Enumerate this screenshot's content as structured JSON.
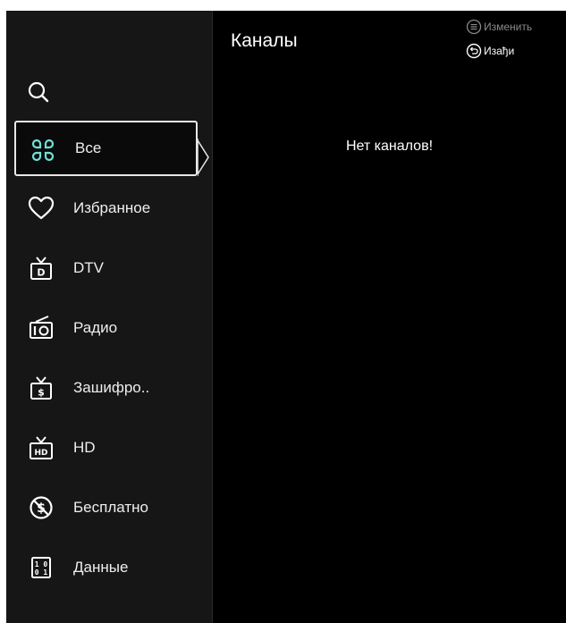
{
  "header": {
    "title": "Каналы",
    "hints": {
      "edit_label": "Изменить",
      "back_label": "Изађи"
    }
  },
  "sidebar": {
    "search_icon": "search-icon",
    "selected_index": 0,
    "items": [
      {
        "label": "Все",
        "icon": "grid-icon",
        "selected": true
      },
      {
        "label": "Избранное",
        "icon": "heart-icon",
        "selected": false
      },
      {
        "label": "DTV",
        "icon": "tv-d-icon",
        "selected": false
      },
      {
        "label": "Радио",
        "icon": "radio-icon",
        "selected": false
      },
      {
        "label": "Зашифро..",
        "icon": "encrypted-tv-icon",
        "selected": false
      },
      {
        "label": "HD",
        "icon": "hd-tv-icon",
        "selected": false
      },
      {
        "label": "Бесплатно",
        "icon": "free-icon",
        "selected": false
      },
      {
        "label": "Данные",
        "icon": "data-icon",
        "selected": false
      }
    ]
  },
  "main": {
    "empty_message": "Нет каналов!"
  },
  "colors": {
    "background": "#000000",
    "sidebar": "#161616",
    "accent_icon": "#6fe0d8",
    "text": "#ffffff",
    "muted_text": "#8a8a8a"
  }
}
